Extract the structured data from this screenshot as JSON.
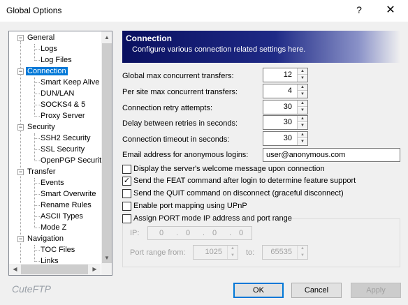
{
  "window": {
    "title": "Global Options",
    "help": "?",
    "close": "✕"
  },
  "tree": {
    "items": [
      {
        "label": "General"
      },
      {
        "label": "Logs"
      },
      {
        "label": "Log Files"
      },
      {
        "label": "Connection"
      },
      {
        "label": "Smart Keep Alive"
      },
      {
        "label": "DUN/LAN"
      },
      {
        "label": "SOCKS4 & 5"
      },
      {
        "label": "Proxy Server"
      },
      {
        "label": "Security"
      },
      {
        "label": "SSH2 Security"
      },
      {
        "label": "SSL Security"
      },
      {
        "label": "OpenPGP Security"
      },
      {
        "label": "Transfer"
      },
      {
        "label": "Events"
      },
      {
        "label": "Smart Overwrite"
      },
      {
        "label": "Rename Rules"
      },
      {
        "label": "ASCII Types"
      },
      {
        "label": "Mode Z"
      },
      {
        "label": "Navigation"
      },
      {
        "label": "TOC Files"
      },
      {
        "label": "Links"
      }
    ],
    "selected": "Connection"
  },
  "panel": {
    "title": "Connection",
    "subtitle": "Configure various connection related settings here."
  },
  "fields": {
    "max_transfers": {
      "label": "Global max concurrent transfers:",
      "value": "12"
    },
    "per_site": {
      "label": "Per site max concurrent transfers:",
      "value": "4"
    },
    "retry": {
      "label": "Connection retry attempts:",
      "value": "30"
    },
    "delay": {
      "label": "Delay between retries in seconds:",
      "value": "30"
    },
    "timeout": {
      "label": "Connection timeout in seconds:",
      "value": "30"
    },
    "email": {
      "label": "Email address for anonymous logins:",
      "value": "user@anonymous.com"
    }
  },
  "checkboxes": {
    "welcome": {
      "label": "Display the server's welcome message upon connection",
      "checked": false
    },
    "feat": {
      "label": "Send the FEAT command after login to determine feature support",
      "checked": true
    },
    "quit": {
      "label": "Send the QUIT command on disconnect (graceful disconnect)",
      "checked": false
    },
    "upnp": {
      "label": "Enable port mapping using UPnP",
      "checked": false
    },
    "port": {
      "label": "Assign PORT mode IP address and port range",
      "checked": false
    }
  },
  "port_group": {
    "ip_label": "IP:",
    "ip_octets": [
      "0",
      "0",
      "0",
      "0"
    ],
    "range_from_label": "Port range from:",
    "range_from": "1025",
    "range_to_label": "to:",
    "range_to": "65535"
  },
  "footer": {
    "brand": "CuteFTP",
    "ok": "OK",
    "cancel": "Cancel",
    "apply": "Apply"
  },
  "colors": {
    "selection": "#0078d7",
    "header_dark": "#0a1060"
  }
}
